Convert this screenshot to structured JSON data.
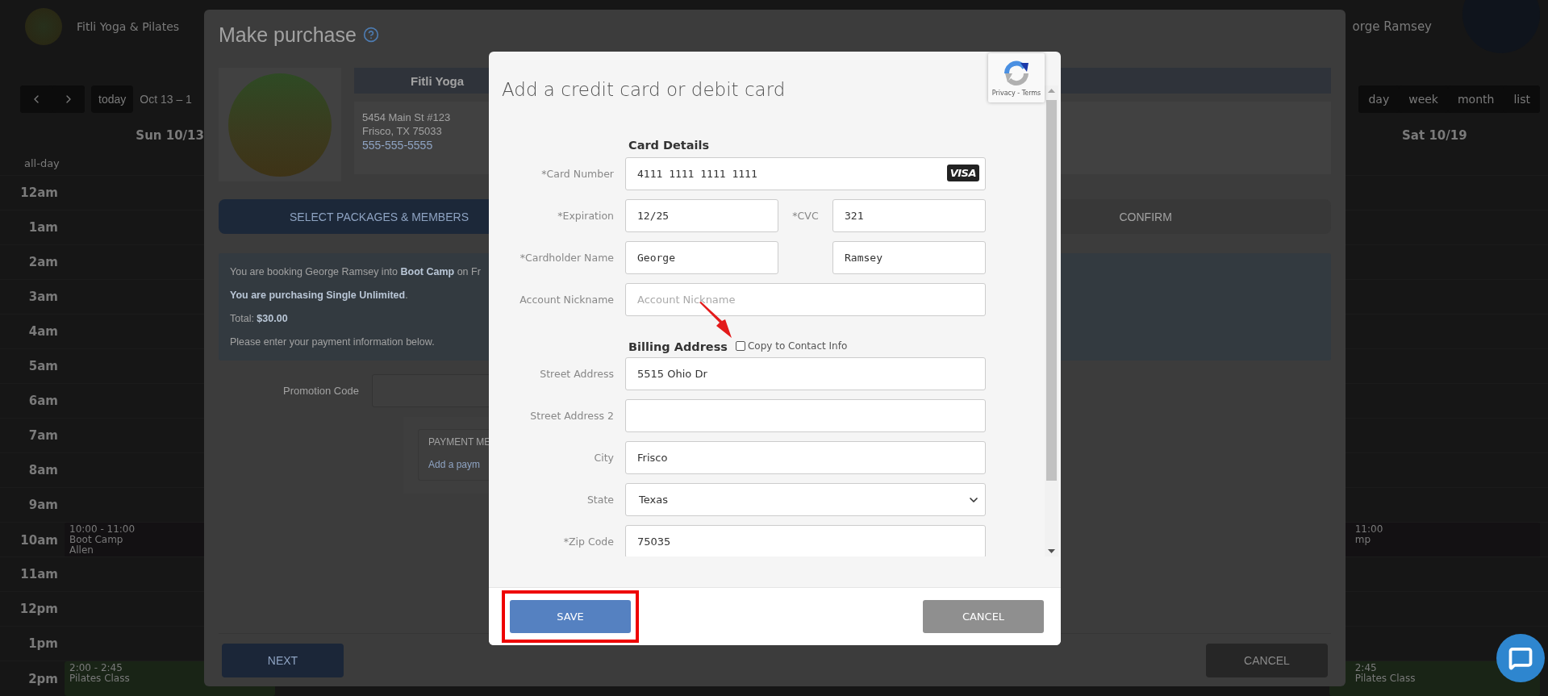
{
  "calendar": {
    "studio_name": "Fitli Yoga & Pilates",
    "user_name": "orge Ramsey",
    "today_button": "today",
    "date_range": "Oct 13 – 1",
    "views": [
      "day",
      "week",
      "month",
      "list"
    ],
    "day_headers": [
      "Sun 10/13",
      "Sat 10/19"
    ],
    "all_day_label": "all-day",
    "hours": [
      {
        "label": "12am"
      },
      {
        "label": "1am"
      },
      {
        "label": "2am"
      },
      {
        "label": "3am"
      },
      {
        "label": "4am"
      },
      {
        "label": "5am"
      },
      {
        "label": "6am"
      },
      {
        "label": "7am"
      },
      {
        "label": "8am"
      },
      {
        "label": "9am"
      },
      {
        "label": "10am",
        "events": [
          {
            "lines": [
              "10:00 - 11:00",
              "Boot Camp",
              "Allen"
            ],
            "color": "#131113"
          },
          {
            "lines": [
              "11:00",
              "mp"
            ],
            "color": "#131113"
          }
        ]
      },
      {
        "label": "11am"
      },
      {
        "label": "12pm"
      },
      {
        "label": "1pm"
      },
      {
        "label": "2pm",
        "events": [
          {
            "lines": [
              "2:00 - 2:45",
              "Pilates Class"
            ],
            "color": "#192416"
          },
          {
            "lines": [
              "2:45",
              "Pilates Class"
            ],
            "color": "#192416"
          }
        ]
      }
    ]
  },
  "purchase": {
    "title": "Make purchase",
    "studio": {
      "name": "Fitli Yoga",
      "address_lines": [
        "5454 Main St #123",
        "Frisco, TX 75033"
      ],
      "phone": "555-555-5555"
    },
    "steps": [
      {
        "label": "SELECT PACKAGES & MEMBERS",
        "selected": true
      },
      {
        "label": "CONFIRM",
        "selected": false
      }
    ],
    "summary": [
      "You are booking George Ramsey into **Boot Camp** on Fr",
      "**You are purchasing Single Unlimited**.",
      "Total: **$30.00**",
      "Please enter your payment information below."
    ],
    "promo_label": "Promotion Code",
    "payment_box": {
      "title": "PAYMENT ME",
      "link": "Add a paym"
    },
    "next_button": "NEXT",
    "cancel_button": "CANCEL"
  },
  "card_dialog": {
    "title": "Add a credit card or debit card",
    "recaptcha": "Privacy - Terms",
    "sections": [
      {
        "heading": "Card Details",
        "fields": [
          {
            "kind": "card",
            "label": "*Card Number",
            "value": "4111 1111 1111 1111",
            "brand": "VISA"
          },
          {
            "kind": "pair",
            "label": "*Expiration",
            "value": "12/25",
            "second_label": "*CVC",
            "second_value": "321"
          },
          {
            "kind": "pair",
            "label": "*Cardholder Name",
            "value": "George",
            "second_value": "Ramsey"
          },
          {
            "kind": "text",
            "label": "Account Nickname",
            "placeholder": "Account Nickname"
          }
        ]
      },
      {
        "heading": "Billing Address",
        "checkbox": {
          "label": "Copy to Contact Info",
          "checked": false
        },
        "fields": [
          {
            "kind": "text",
            "label": "Street Address",
            "value": "5515 Ohio Dr"
          },
          {
            "kind": "text",
            "label": "Street Address 2"
          },
          {
            "kind": "text",
            "label": "City",
            "value": "Frisco"
          },
          {
            "kind": "select",
            "label": "State",
            "value": "Texas"
          },
          {
            "kind": "text",
            "label": "*Zip Code",
            "value": "75035"
          }
        ]
      }
    ],
    "save_button": "SAVE",
    "cancel_button": "CANCEL"
  }
}
